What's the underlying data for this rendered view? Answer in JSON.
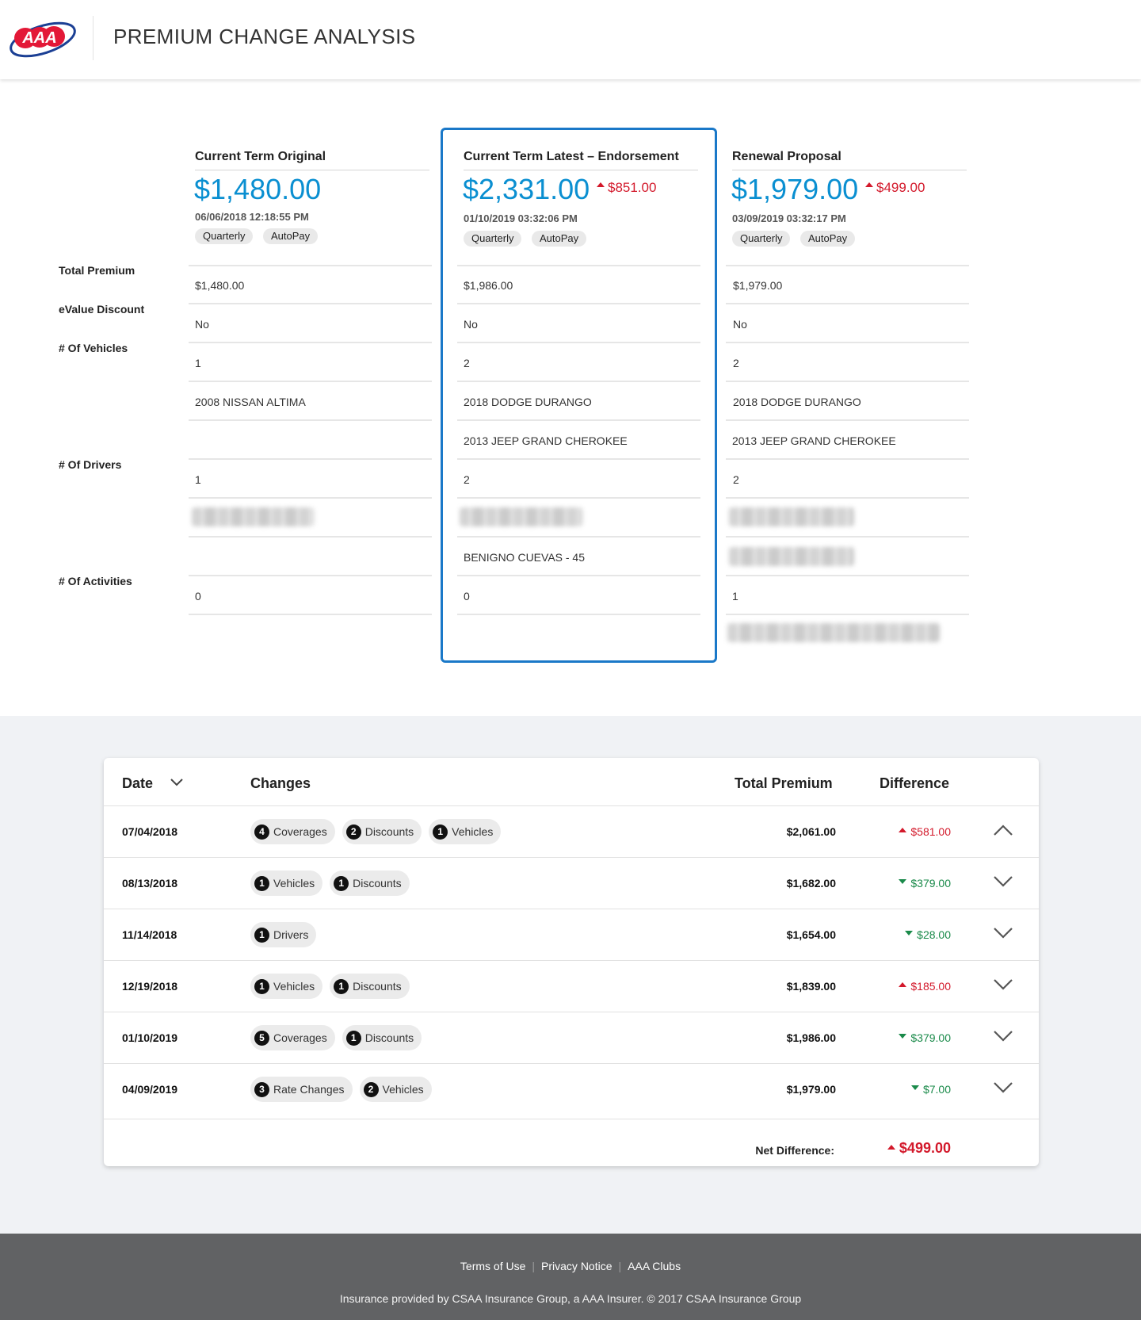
{
  "header": {
    "logo_text": "AAA",
    "title": "PREMIUM CHANGE ANALYSIS"
  },
  "row_labels": {
    "total_premium": "Total Premium",
    "evalue": "eValue Discount",
    "vehicles": "# Of Vehicles",
    "drivers": "# Of Drivers",
    "activities": "# Of Activities"
  },
  "columns": [
    {
      "title": "Current Term Original",
      "amount": "$1,480.00",
      "delta": "",
      "datetime": "06/06/2018 12:18:55 PM",
      "tags": [
        "Quarterly",
        "AutoPay"
      ],
      "total_premium": "$1,480.00",
      "evalue": "No",
      "vehicles_count": "1",
      "vehicles": [
        "2008 NISSAN ALTIMA",
        ""
      ],
      "drivers_count": "1",
      "drivers": [
        "",
        ""
      ],
      "activities_count": "0"
    },
    {
      "title": "Current Term Latest – Endorsement",
      "amount": "$2,331.00",
      "delta": "$851.00",
      "datetime": "01/10/2019 03:32:06 PM",
      "tags": [
        "Quarterly",
        "AutoPay"
      ],
      "total_premium": "$1,986.00",
      "evalue": "No",
      "vehicles_count": "2",
      "vehicles": [
        "2018 DODGE DURANGO",
        "2013 JEEP GRAND CHEROKEE"
      ],
      "drivers_count": "2",
      "drivers": [
        "",
        "BENIGNO CUEVAS - 45"
      ],
      "activities_count": "0"
    },
    {
      "title": "Renewal Proposal",
      "amount": "$1,979.00",
      "delta": "$499.00",
      "datetime": "03/09/2019  03:32:17 PM",
      "tags": [
        "Quarterly",
        "AutoPay"
      ],
      "total_premium": "$1,979.00",
      "evalue": "No",
      "vehicles_count": "2",
      "vehicles": [
        "2018 DODGE DURANGO",
        "2013 JEEP GRAND CHEROKEE"
      ],
      "drivers_count": "2",
      "drivers": [
        "",
        ""
      ],
      "activities_count": "1"
    }
  ],
  "changes_table": {
    "headers": {
      "date": "Date",
      "changes": "Changes",
      "total": "Total Premium",
      "diff": "Difference"
    },
    "rows": [
      {
        "date": "07/04/2018",
        "chips": [
          [
            "4",
            "Coverages"
          ],
          [
            "2",
            "Discounts"
          ],
          [
            "1",
            "Vehicles"
          ]
        ],
        "total": "$2,061.00",
        "diff": "$581.00",
        "dir": "up",
        "expanded": true
      },
      {
        "date": "08/13/2018",
        "chips": [
          [
            "1",
            "Vehicles"
          ],
          [
            "1",
            "Discounts"
          ]
        ],
        "total": "$1,682.00",
        "diff": "$379.00",
        "dir": "down",
        "expanded": false
      },
      {
        "date": "11/14/2018",
        "chips": [
          [
            "1",
            "Drivers"
          ]
        ],
        "total": "$1,654.00",
        "diff": "$28.00",
        "dir": "down",
        "expanded": false
      },
      {
        "date": "12/19/2018",
        "chips": [
          [
            "1",
            "Vehicles"
          ],
          [
            "1",
            "Discounts"
          ]
        ],
        "total": "$1,839.00",
        "diff": "$185.00",
        "dir": "up",
        "expanded": false
      },
      {
        "date": "01/10/2019",
        "chips": [
          [
            "5",
            "Coverages"
          ],
          [
            "1",
            "Discounts"
          ]
        ],
        "total": "$1,986.00",
        "diff": "$379.00",
        "dir": "down",
        "expanded": false
      },
      {
        "date": "04/09/2019",
        "chips": [
          [
            "3",
            "Rate Changes"
          ],
          [
            "2",
            "Vehicles"
          ]
        ],
        "total": "$1,979.00",
        "diff": "$7.00",
        "dir": "down",
        "expanded": false
      }
    ],
    "net_label": "Net Difference:",
    "net_value": "$499.00"
  },
  "footer": {
    "links": [
      "Terms of Use",
      "Privacy Notice",
      "AAA Clubs"
    ],
    "copyright": "Insurance provided by CSAA Insurance Group, a AAA Insurer. © 2017 CSAA Insurance Group"
  },
  "colors": {
    "accent_blue": "#0a8fd1",
    "highlight_border": "#1a78c8",
    "increase_red": "#d3192b",
    "decrease_green": "#1a8a4a",
    "footer_bg": "#616264"
  }
}
